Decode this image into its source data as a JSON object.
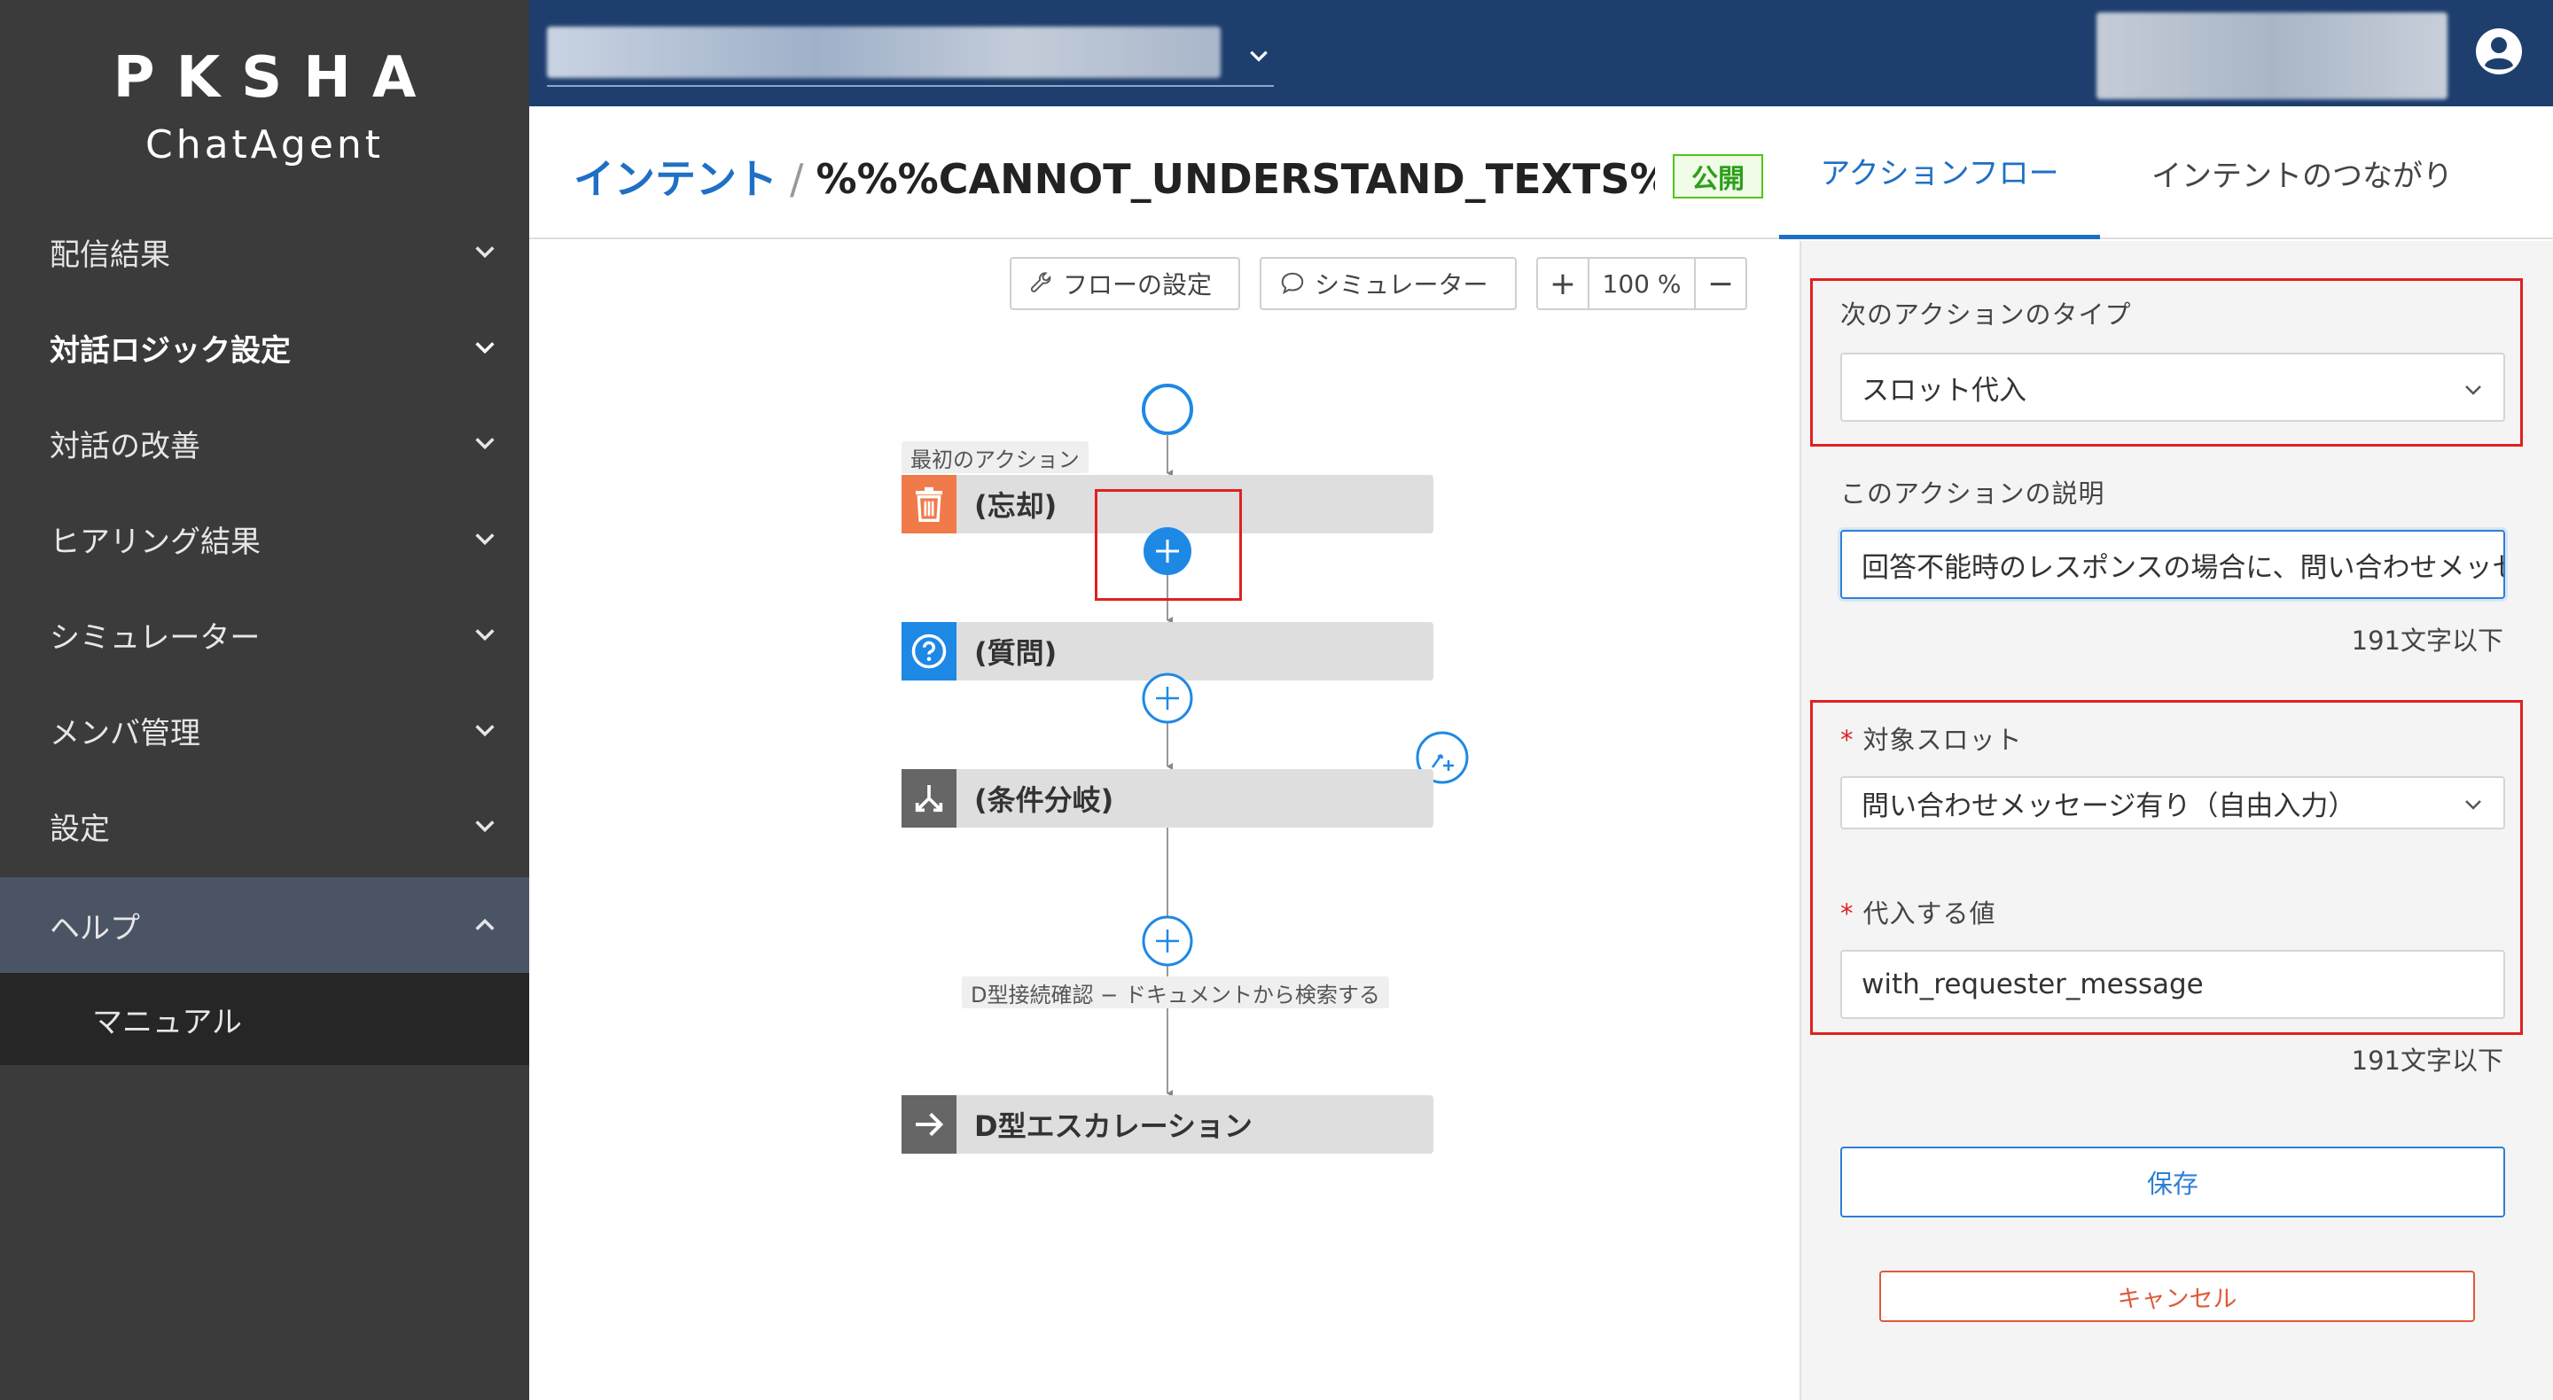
{
  "brand": {
    "line1": "PKSHA",
    "line2": "ChatAgent"
  },
  "sidebar": {
    "items": [
      {
        "label": "配信結果"
      },
      {
        "label": "対話ロジック設定"
      },
      {
        "label": "対話の改善"
      },
      {
        "label": "ヒアリング結果"
      },
      {
        "label": "シミュレーター"
      },
      {
        "label": "メンバ管理"
      },
      {
        "label": "設定"
      },
      {
        "label": "ヘルプ"
      }
    ],
    "submenu": {
      "label": "マニュアル"
    }
  },
  "topbar": {
    "project": "",
    "user": ""
  },
  "header": {
    "breadcrumb_link": "インテント",
    "separator": "/",
    "title": "%%%CANNOT_UNDERSTAND_TEXTS%%%デ",
    "status": "公開",
    "tabs": [
      {
        "label": "アクションフロー"
      },
      {
        "label": "インテントのつながり"
      }
    ]
  },
  "toolbar": {
    "flow_settings": "フローの設定",
    "simulator": "シミュレーター",
    "zoom_in": "+",
    "zoom_value": "100 %",
    "zoom_out": "−"
  },
  "flow": {
    "first_action_tag": "最初のアクション",
    "nodes": [
      {
        "label": "(忘却)",
        "icon": "trash-icon",
        "color": "#f07a4a"
      },
      {
        "label": "(質問)",
        "icon": "question-icon",
        "color": "#1e88e5"
      },
      {
        "label": "(条件分岐)",
        "icon": "branch-icon",
        "color": "#666666"
      },
      {
        "label": "D型エスカレーション",
        "icon": "arrow-right-icon",
        "color": "#666666"
      }
    ],
    "branch_label": "D型接続確認 − ドキュメントから検索する"
  },
  "panel": {
    "next_action_type_label": "次のアクションのタイプ",
    "next_action_type_value": "スロット代入",
    "description_label": "このアクションの説明",
    "description_value": "回答不能時のレスポンスの場合に、問い合わせメッセ",
    "description_hint": "191文字以下",
    "slot_label": "対象スロット",
    "slot_value": "問い合わせメッセージ有り（自由入力）",
    "assign_label": "代入する値",
    "assign_value": "with_requester_message",
    "assign_hint": "191文字以下",
    "save": "保存",
    "cancel": "キャンセル"
  },
  "colors": {
    "accent": "#1f6fc5",
    "topbar": "#1e3f6e",
    "sidebar": "#3b3b3b",
    "highlight": "#e02020"
  }
}
